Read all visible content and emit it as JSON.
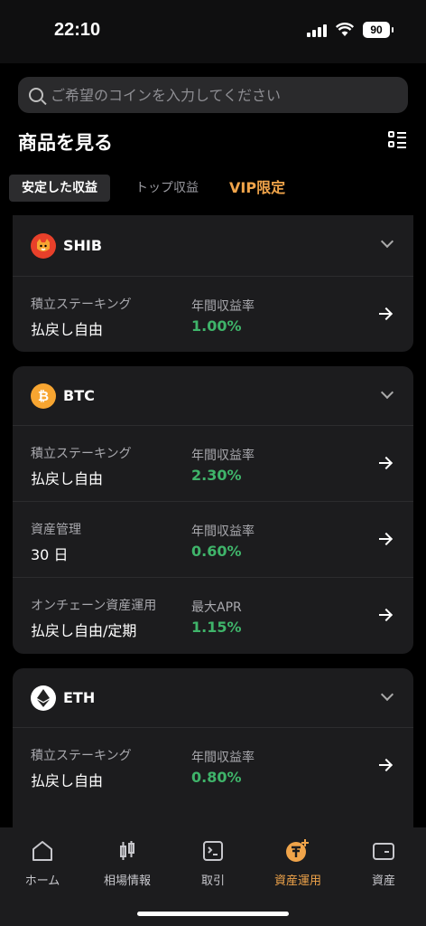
{
  "status_bar": {
    "time": "22:10",
    "battery": "90"
  },
  "search": {
    "placeholder": "ご希望のコインを入力してください"
  },
  "header": {
    "title": "商品を見る"
  },
  "tabs": [
    {
      "label": "安定した収益"
    },
    {
      "label": "トップ収益"
    },
    {
      "label": "VIP限定"
    }
  ],
  "cards": [
    {
      "coin": "SHIB",
      "logo_color": "#e8402a",
      "products": [
        {
          "type": "積立ステーキング",
          "term": "払戻し自由",
          "rate_label": "年間収益率",
          "rate": "1.00%"
        }
      ]
    },
    {
      "coin": "BTC",
      "logo_color": "#f7a531",
      "products": [
        {
          "type": "積立ステーキング",
          "term": "払戻し自由",
          "rate_label": "年間収益率",
          "rate": "2.30%"
        },
        {
          "type": "資産管理",
          "term": "30 日",
          "rate_label": "年間収益率",
          "rate": "0.60%"
        },
        {
          "type": "オンチェーン資産運用",
          "term": "払戻し自由/定期",
          "rate_label": "最大APR",
          "rate": "1.15%"
        }
      ]
    },
    {
      "coin": "ETH",
      "logo_color": "#ffffff",
      "products": [
        {
          "type": "積立ステーキング",
          "term": "払戻し自由",
          "rate_label": "年間収益率",
          "rate": "0.80%"
        }
      ]
    }
  ],
  "bottom_nav": [
    {
      "label": "ホーム",
      "icon": "home-icon"
    },
    {
      "label": "相場情報",
      "icon": "candlestick-icon"
    },
    {
      "label": "取引",
      "icon": "trade-icon"
    },
    {
      "label": "資産運用",
      "icon": "earn-icon",
      "active": true
    },
    {
      "label": "資産",
      "icon": "wallet-icon"
    }
  ],
  "colors": {
    "accent": "#f0a44a",
    "positive": "#3fb46a"
  }
}
